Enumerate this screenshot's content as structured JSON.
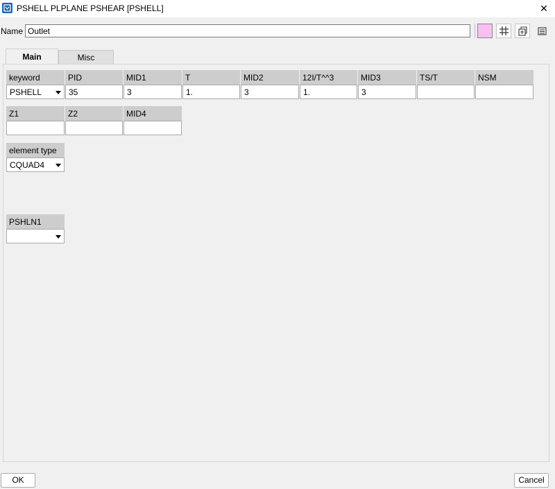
{
  "window": {
    "title": "PSHELL PLPLANE PSHEAR [PSHELL]",
    "close_glyph": "✕"
  },
  "name_row": {
    "label": "Name",
    "value": "Outlet",
    "color": "#f9bff3"
  },
  "toolbar_icons": [
    "grid-settings-icon",
    "copy-settings-icon",
    "list-icon"
  ],
  "tabs": [
    {
      "label": "Main",
      "active": true
    },
    {
      "label": "Misc",
      "active": false
    }
  ],
  "row1": {
    "headers": [
      "keyword",
      "PID",
      "MID1",
      "T",
      "MID2",
      "12I/T^^3",
      "MID3",
      "TS/T",
      "NSM"
    ],
    "values": [
      "PSHELL",
      "35",
      "3",
      "1.",
      "3",
      "1.",
      "3",
      "",
      ""
    ]
  },
  "row2": {
    "headers": [
      "Z1",
      "Z2",
      "MID4"
    ],
    "values": [
      "",
      "",
      ""
    ]
  },
  "element_type": {
    "header": "element type",
    "value": "CQUAD4"
  },
  "pshln1": {
    "header": "PSHLN1",
    "value": ""
  },
  "buttons": {
    "ok": "OK",
    "cancel": "Cancel"
  }
}
